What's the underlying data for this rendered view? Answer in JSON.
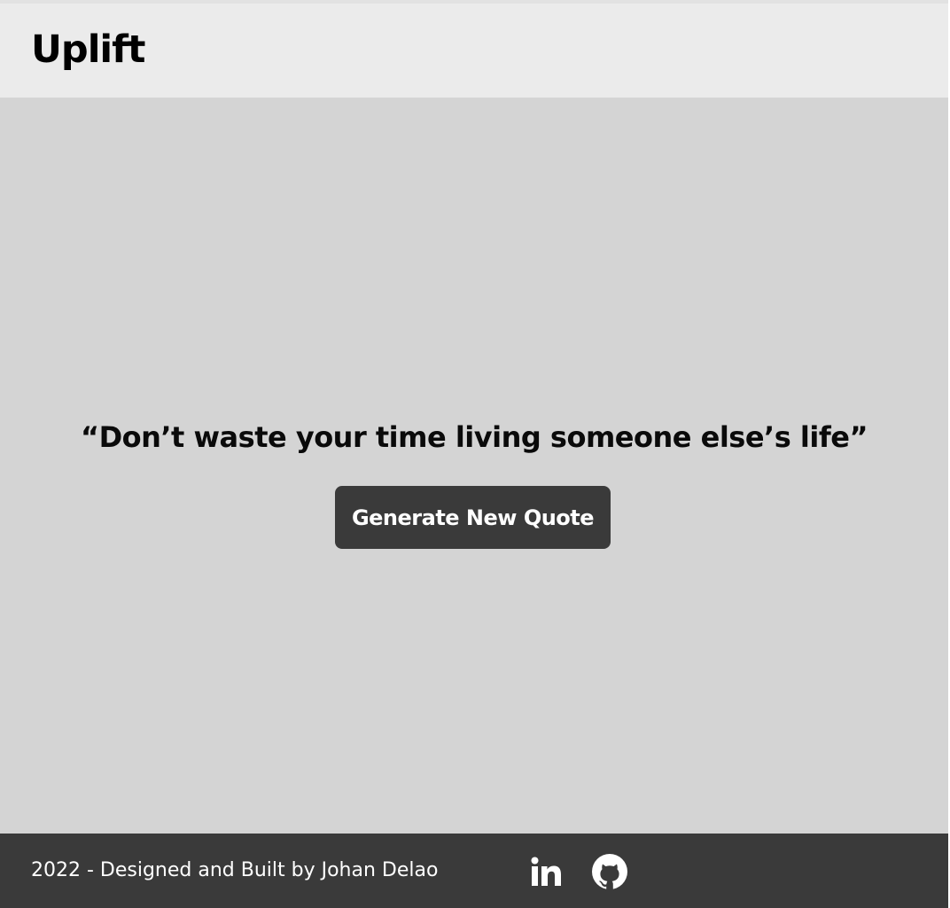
{
  "header": {
    "logo_text": "Uplift"
  },
  "main": {
    "quote_text": "“Don’t waste your time living someone else’s life”",
    "generate_button_label": "Generate New Quote"
  },
  "footer": {
    "credit_text": "2022 - Designed and Built by Johan Delao",
    "social_icons": [
      "linkedin-icon",
      "github-icon"
    ]
  },
  "colors": {
    "header_bg": "#ebebeb",
    "main_bg": "#d4d4d4",
    "button_bg": "#3a3a3a",
    "footer_bg": "#3a3a3a",
    "footer_text": "#ffffff"
  }
}
